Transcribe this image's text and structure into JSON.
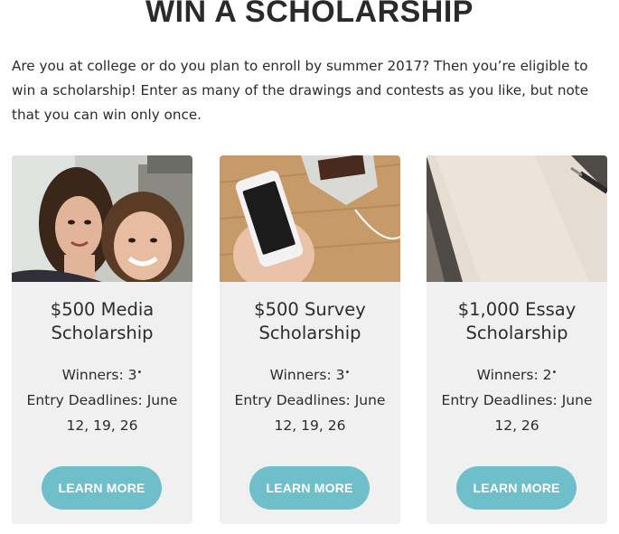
{
  "page": {
    "heading": "WIN A SCHOLARSHIP",
    "intro": "Are you at college or do you plan to enroll by summer 2017? Then you’re eligible to win a scholarship! Enter as many of the drawings and contests as you like, but note that you can win only once."
  },
  "cards": [
    {
      "image": "two-girls-selfie-photo",
      "title": "$500 Media Scholarship",
      "winners": "Winners: 3",
      "winners_mark": "•",
      "deadlines": "Entry Deadlines: June 12, 19, 26",
      "button_label": "LEARN MORE"
    },
    {
      "image": "hand-holding-phone-photo",
      "title": "$500 Survey Scholarship",
      "winners": "Winners: 3",
      "winners_mark": "•",
      "deadlines": "Entry Deadlines: June 12, 19, 26",
      "button_label": "LEARN MORE"
    },
    {
      "image": "notebook-and-pen-photo",
      "title": "$1,000 Essay Scholarship",
      "winners": "Winners: 2",
      "winners_mark": "•",
      "deadlines": "Entry Deadlines: June 12, 26",
      "button_label": "LEARN MORE"
    }
  ],
  "colors": {
    "card_background": "#f0f0f0",
    "button": "#6fbfcb",
    "text": "#2b2b2b"
  }
}
